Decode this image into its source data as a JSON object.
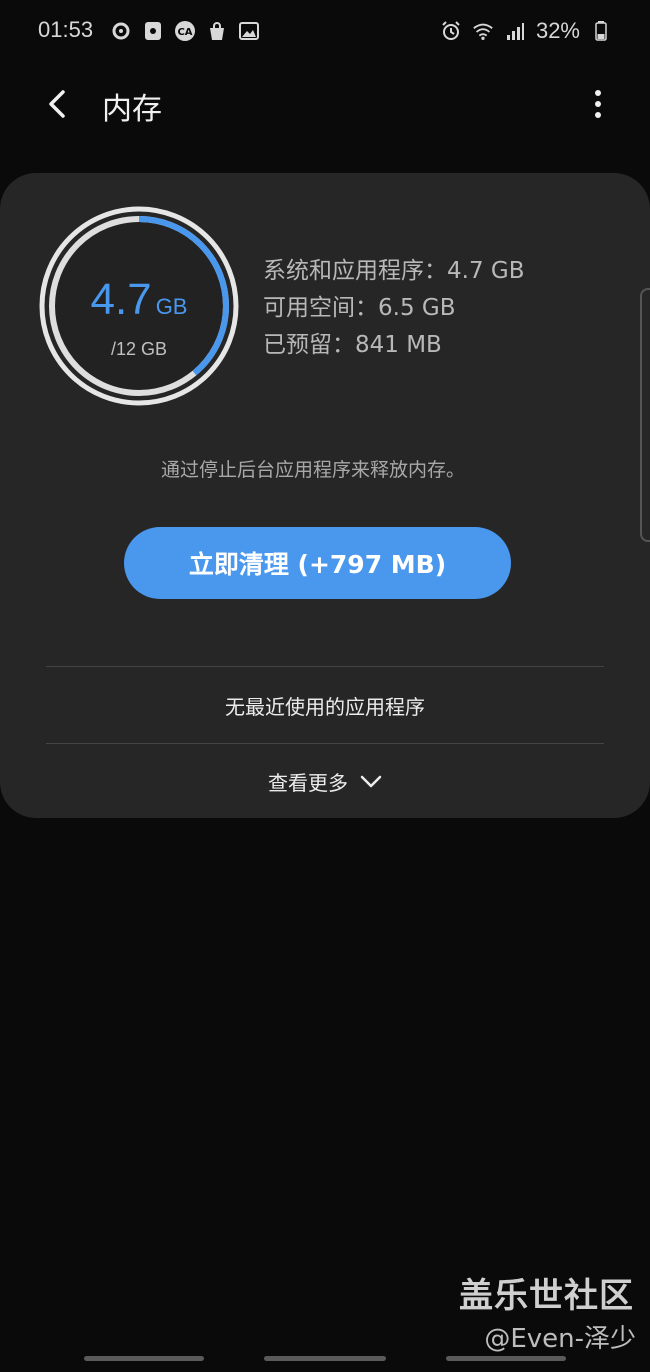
{
  "status_bar": {
    "time": "01:53",
    "left_icons": [
      "record-icon",
      "sd-card-icon",
      "ca-app-icon",
      "shopping-bag-icon",
      "image-icon"
    ],
    "right_icons": [
      "alarm-icon",
      "wifi-icon",
      "signal-icon"
    ],
    "battery_percent": "32%"
  },
  "app_bar": {
    "title": "内存"
  },
  "memory": {
    "used_value": "4.7",
    "used_unit": "GB",
    "total": "/12 GB",
    "used_fraction": 0.39,
    "stats": [
      "系统和应用程序：4.7 GB",
      "可用空间：6.5 GB",
      "已预留：841 MB"
    ],
    "hint": "通过停止后台应用程序来释放内存。",
    "clean_button_label": "立即清理 (+797 MB)",
    "no_recent_text": "无最近使用的应用程序",
    "see_more_label": "查看更多"
  },
  "colors": {
    "accent": "#4a97ee",
    "card_bg": "#262626",
    "page_bg": "#0a0a0a"
  },
  "watermark": {
    "brand": "盖乐世社区",
    "author": "@Even-泽少"
  }
}
